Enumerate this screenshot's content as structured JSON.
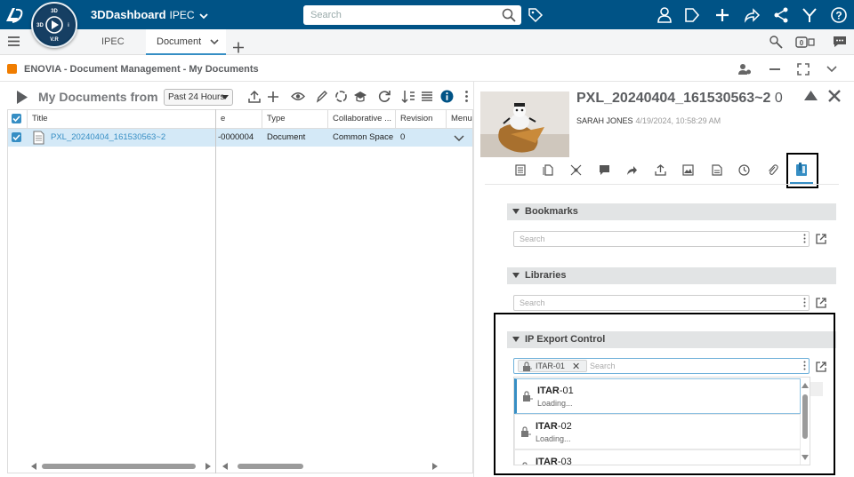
{
  "topbar": {
    "brand": "3DDashboard",
    "tenant": "IPEC",
    "compass_labels": {
      "top": "3D",
      "left": "3D",
      "bottom": "V.R",
      "right": "i"
    },
    "search_placeholder": "Search",
    "icons": [
      "tag-icon",
      "user-icon",
      "share-tag-icon",
      "add-icon",
      "forward-icon",
      "network-icon",
      "tools-icon",
      "help-icon"
    ]
  },
  "tabs": {
    "items": [
      "IPEC",
      "Document"
    ],
    "active": "Document"
  },
  "app_title": "ENOVIA - Document Management - My Documents",
  "left_panel": {
    "title": "My Documents from",
    "period": "Past 24 Hours",
    "columns": [
      "Title",
      "e",
      "Type",
      "Collaborative ...",
      "Revision",
      "Menu"
    ],
    "rows": [
      {
        "title": "PXL_20240404_161530563~2",
        "name": "-0000004",
        "type": "Document",
        "collab": "Common Space",
        "revision": "0"
      }
    ]
  },
  "right_panel": {
    "doc_title": "PXL_20240404_161530563~2",
    "doc_rev": "0",
    "owner": "SARAH JONES",
    "date": "4/19/2024, 10:58:29 AM",
    "sections": {
      "bookmarks": {
        "label": "Bookmarks",
        "placeholder": "Search"
      },
      "libraries": {
        "label": "Libraries",
        "placeholder": "Search"
      },
      "ip_export": {
        "label": "IP Export Control",
        "chip": "ITAR-01",
        "placeholder": "Search"
      }
    },
    "options": [
      {
        "bold": "ITAR",
        "rest": "-01",
        "status": "Loading..."
      },
      {
        "bold": "ITAR",
        "rest": "-02",
        "status": "Loading..."
      },
      {
        "bold": "ITAR",
        "rest": "-03",
        "status": ""
      }
    ]
  },
  "colors": {
    "header": "#005386",
    "accent": "#368ec4",
    "row_selected": "#d4e9f7",
    "app_icon": "#f07d00"
  }
}
